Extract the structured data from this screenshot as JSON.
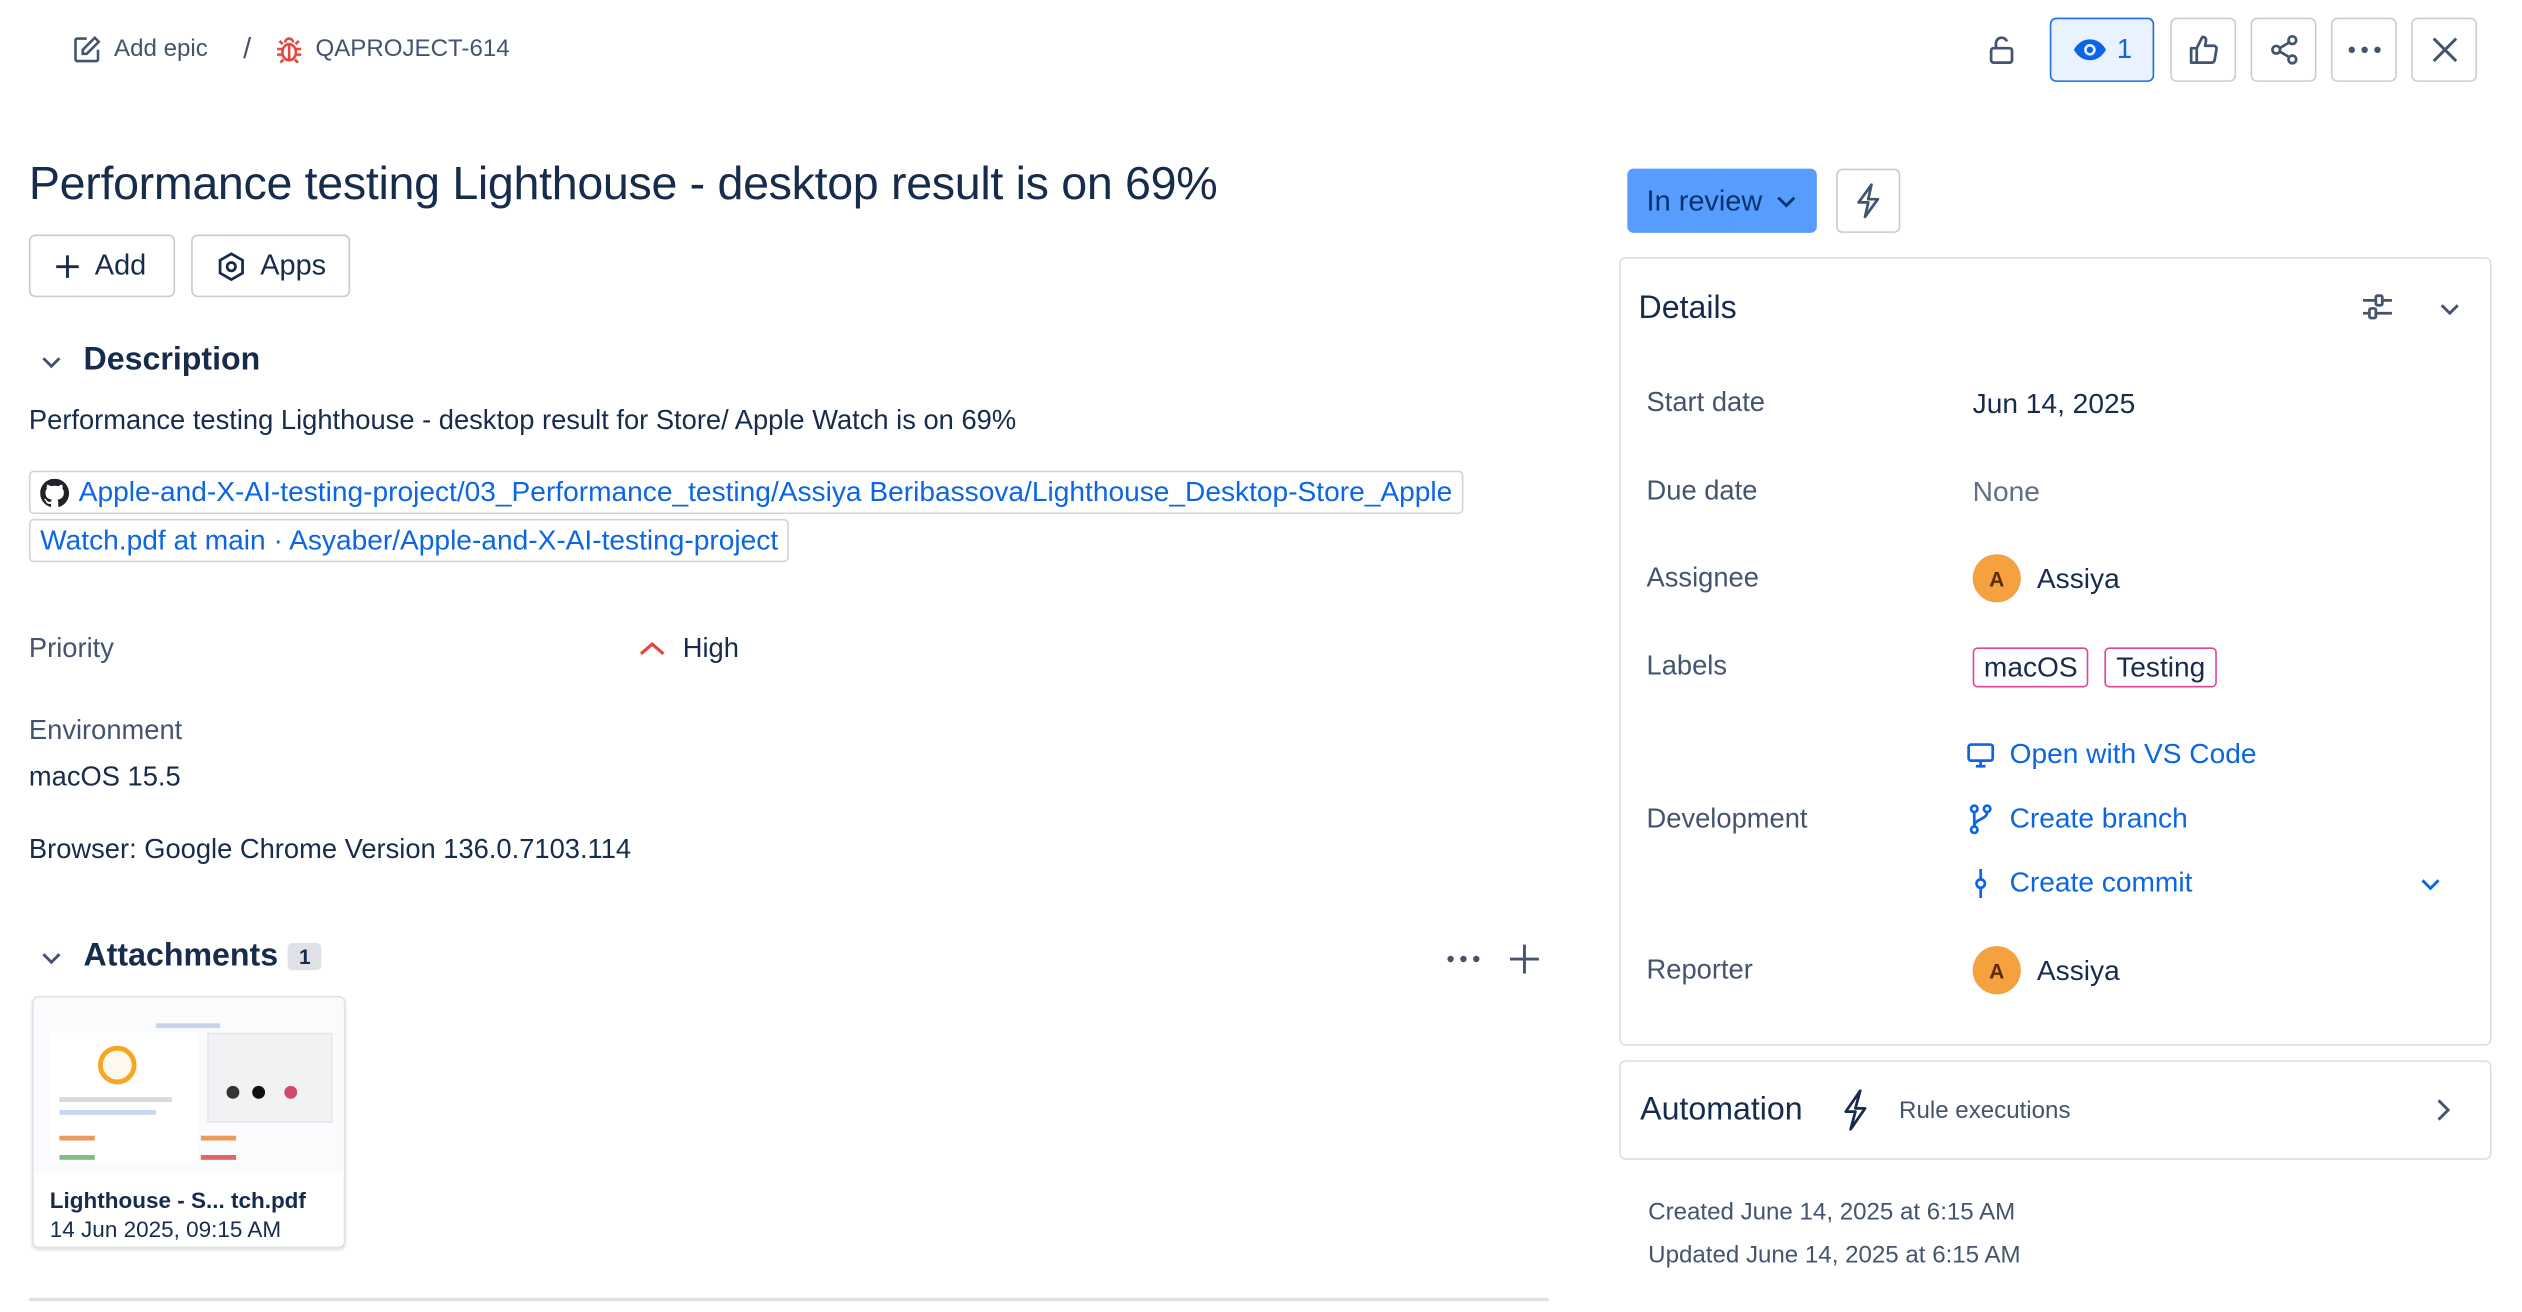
{
  "breadcrumb": {
    "add_epic_label": "Add epic",
    "separator": "/",
    "issue_key": "QAPROJECT-614"
  },
  "toolbar": {
    "watch_count": "1"
  },
  "issue": {
    "title": "Performance testing Lighthouse - desktop result is on 69%",
    "add_label": "Add",
    "apps_label": "Apps"
  },
  "description": {
    "heading": "Description",
    "text": "Performance testing Lighthouse - desktop result for Store/ Apple Watch is on 69%",
    "link_line1": "Apple-and-X-AI-testing-project/03_Performance_testing/Assiya Beribassova/Lighthouse_Desktop-Store_Apple",
    "link_line2": "Watch.pdf at main · Asyaber/Apple-and-X-AI-testing-project"
  },
  "priority": {
    "label": "Priority",
    "value": "High"
  },
  "environment": {
    "label": "Environment",
    "os": "macOS 15.5",
    "browser": "Browser: Google Chrome Version 136.0.7103.114"
  },
  "attachments": {
    "heading": "Attachments",
    "count": "1",
    "items": [
      {
        "name": "Lighthouse - S... tch.pdf",
        "date": "14 Jun 2025, 09:15 AM"
      }
    ]
  },
  "status": {
    "label": "In review"
  },
  "details": {
    "heading": "Details",
    "start_date_label": "Start date",
    "start_date": "Jun 14, 2025",
    "due_date_label": "Due date",
    "due_date": "None",
    "assignee_label": "Assignee",
    "assignee_initial": "A",
    "assignee": "Assiya",
    "labels_label": "Labels",
    "labels": [
      "macOS",
      "Testing"
    ],
    "development_label": "Development",
    "dev_open_vscode": "Open with VS Code",
    "dev_create_branch": "Create branch",
    "dev_create_commit": "Create commit",
    "reporter_label": "Reporter",
    "reporter_initial": "A",
    "reporter": "Assiya"
  },
  "automation": {
    "heading": "Automation",
    "rule_executions": "Rule executions"
  },
  "meta": {
    "created": "Created June 14, 2025 at 6:15 AM",
    "updated": "Updated June 14, 2025 at 6:15 AM"
  },
  "colors": {
    "link": "#0c66e4",
    "status_bg": "#579dff",
    "priority_high": "#e2483d",
    "bug_icon": "#e2483d",
    "label_border": "#e0449a",
    "avatar": "#f5a140"
  }
}
